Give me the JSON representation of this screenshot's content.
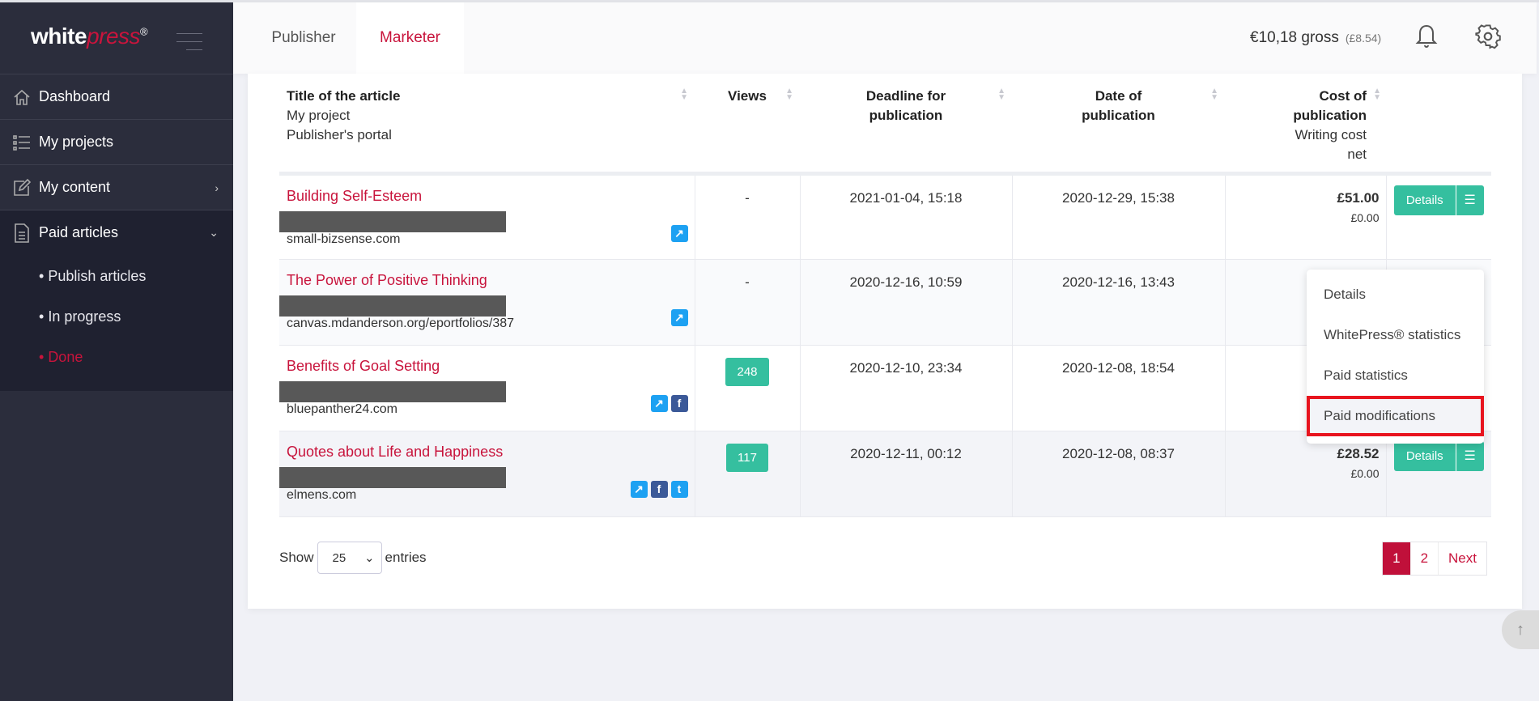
{
  "brand": {
    "logo_white": "white",
    "logo_accent": "press",
    "logo_reg": "®"
  },
  "sidebar": {
    "items": [
      {
        "label": "Dashboard",
        "icon": "home-icon"
      },
      {
        "label": "My projects",
        "icon": "list-icon"
      },
      {
        "label": "My content",
        "icon": "edit-icon"
      },
      {
        "label": "Paid articles",
        "icon": "document-icon"
      }
    ],
    "subitems": [
      {
        "label": "Publish articles"
      },
      {
        "label": "In progress"
      },
      {
        "label": "Done",
        "active": true
      }
    ]
  },
  "header": {
    "tabs": [
      {
        "label": "Publisher"
      },
      {
        "label": "Marketer",
        "active": true
      }
    ],
    "balance": "€10,18 gross",
    "balance_sub": "(£8.54)"
  },
  "table": {
    "columns": {
      "title": "Title of the article",
      "title_sub1": "My project",
      "title_sub2": "Publisher's portal",
      "views": "Views",
      "deadline": "Deadline for publication",
      "date": "Date of publication",
      "cost": "Cost of publication",
      "cost_sub1": "Writing cost",
      "cost_sub2": "net"
    },
    "rows": [
      {
        "title": "Building Self-Esteem",
        "domain": "small-bizsense.com",
        "views": "-",
        "deadline": "2021-01-04, 15:18",
        "date": "2020-12-29, 15:38",
        "cost": "£51.00",
        "writing": "£0.00",
        "details": "Details"
      },
      {
        "title": "The Power of Positive Thinking",
        "domain": "canvas.mdanderson.org/eportfolios/387",
        "views": "-",
        "deadline": "2020-12-16, 10:59",
        "date": "2020-12-16, 13:43",
        "cost": "",
        "writing": "",
        "details": ""
      },
      {
        "title": "Benefits of Goal Setting",
        "domain": "bluepanther24.com",
        "views": "248",
        "deadline": "2020-12-10, 23:34",
        "date": "2020-12-08, 18:54",
        "cost": "",
        "writing": "",
        "details": ""
      },
      {
        "title": "Quotes about Life and Happiness",
        "domain": "elmens.com",
        "views": "117",
        "deadline": "2020-12-11, 00:12",
        "date": "2020-12-08, 08:37",
        "cost": "£28.52",
        "writing": "£0.00",
        "details": "Details"
      }
    ]
  },
  "footer": {
    "show": "Show",
    "entries": "entries",
    "page_length": "25",
    "pages": [
      "1",
      "2"
    ],
    "next": "Next",
    "current_page": "1"
  },
  "dropdown": {
    "items": [
      "Details",
      "WhitePress® statistics",
      "Paid statistics",
      "Paid modifications"
    ],
    "highlighted": "Paid modifications"
  },
  "colors": {
    "accent": "#c8143c",
    "green": "#35bf9f",
    "sidebar": "#2b2d3c",
    "highlight_border": "#e8141e"
  }
}
